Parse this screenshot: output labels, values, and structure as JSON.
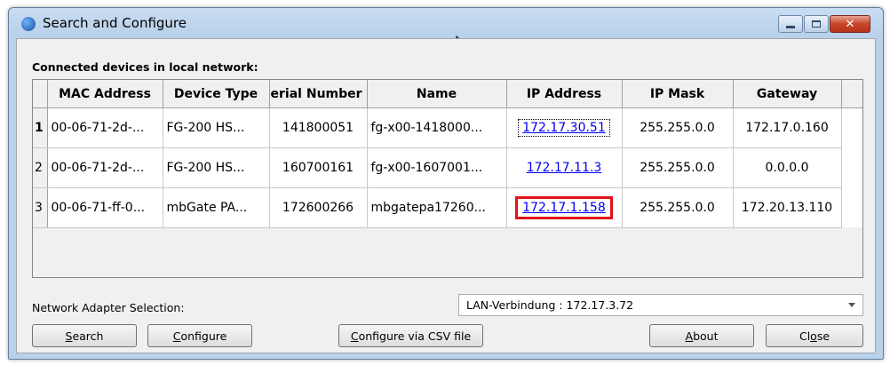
{
  "window": {
    "title": "Search and Configure",
    "buttons": {
      "minimize": "minimize-icon",
      "maximize": "maximize-icon",
      "close": "close-icon"
    }
  },
  "section_label": "Connected devices in local network:",
  "table": {
    "headers": [
      "MAC Address",
      "Device Type",
      "Serial Number",
      "Name",
      "IP Address",
      "IP Mask",
      "Gateway"
    ],
    "rows": [
      {
        "num": "1",
        "mac": "00-06-71-2d-...",
        "type": "FG-200 HS...",
        "serial": "141800051",
        "name": "fg-x00-1418000...",
        "ip": "172.17.30.51",
        "mask": "255.255.0.0",
        "gateway": "172.17.0.160"
      },
      {
        "num": "2",
        "mac": "00-06-71-2d-...",
        "type": "FG-200 HS...",
        "serial": "160700161",
        "name": "fg-x00-1607001...",
        "ip": "172.17.11.3",
        "mask": "255.255.0.0",
        "gateway": "0.0.0.0"
      },
      {
        "num": "3",
        "mac": "00-06-71-ff-0...",
        "type": "mbGate PA...",
        "serial": "172600266",
        "name": "mbgatepa17260...",
        "ip": "172.17.1.158",
        "mask": "255.255.0.0",
        "gateway": "172.20.13.110"
      }
    ]
  },
  "adapter": {
    "label": "Network Adapter Selection:",
    "value": "LAN-Verbindung  : 172.17.3.72"
  },
  "buttons": {
    "search": {
      "mnemonic": "S",
      "rest": "earch"
    },
    "configure": {
      "mnemonic": "C",
      "rest": "onfigure"
    },
    "csv": {
      "mnemonic": "C",
      "rest": "onfigure via CSV file"
    },
    "about": {
      "mnemonic": "A",
      "rest": "bout"
    },
    "close": {
      "pre": "Cl",
      "mnemonic": "o",
      "rest": "se"
    }
  },
  "colors": {
    "link": "#0000ee",
    "highlight": "#e0131b",
    "title_bg": "#b9d1ea"
  }
}
